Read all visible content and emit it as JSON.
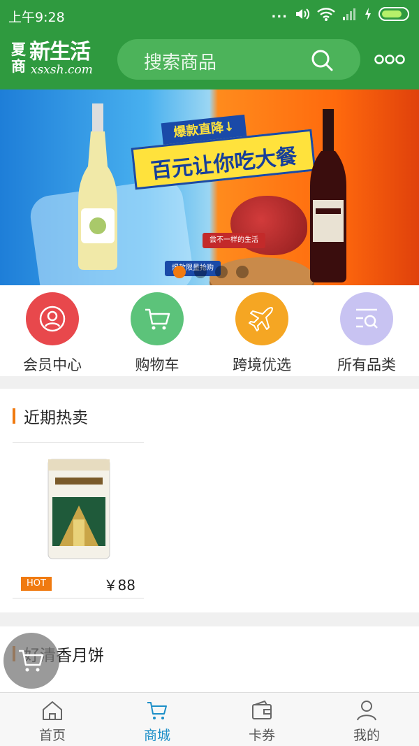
{
  "status_bar": {
    "time": "上午9:28",
    "dots": "..."
  },
  "header": {
    "logo": {
      "line1": "夏",
      "line2": "商",
      "main": "新生活",
      "sub": "xsxsh.com"
    },
    "search_placeholder": "搜索商品",
    "icons": [
      "search-icon",
      "more-icon"
    ]
  },
  "banner": {
    "tag": "爆款直降↓",
    "title": "百元让你吃大餐",
    "note": "尝不一样的生活",
    "note2": "爆款限量抢购",
    "slide_count": 4,
    "active_slide": 1
  },
  "quick_menu": [
    {
      "label": "会员中心",
      "icon": "user-icon",
      "color": "#e8484c"
    },
    {
      "label": "购物车",
      "icon": "cart-icon",
      "color": "#5cc37a"
    },
    {
      "label": "跨境优选",
      "icon": "plane-icon",
      "color": "#f5a623"
    },
    {
      "label": "所有品类",
      "icon": "category-search-icon",
      "color": "#c8c3f2"
    }
  ],
  "hot_section": {
    "title": "近期热卖",
    "products": [
      {
        "badge": "HOT",
        "price": "￥88",
        "image": "rice-bag"
      }
    ]
  },
  "moon_section": {
    "title": "好清香月饼"
  },
  "bottom_nav": [
    {
      "label": "首页",
      "icon": "home-icon",
      "active": false
    },
    {
      "label": "商城",
      "icon": "cart-icon",
      "active": true
    },
    {
      "label": "卡券",
      "icon": "wallet-icon",
      "active": false
    },
    {
      "label": "我的",
      "icon": "person-icon",
      "active": false
    }
  ],
  "colors": {
    "brand_green": "#2f9a3f",
    "accent_orange": "#f07a10",
    "active_nav": "#1d8fc8"
  }
}
